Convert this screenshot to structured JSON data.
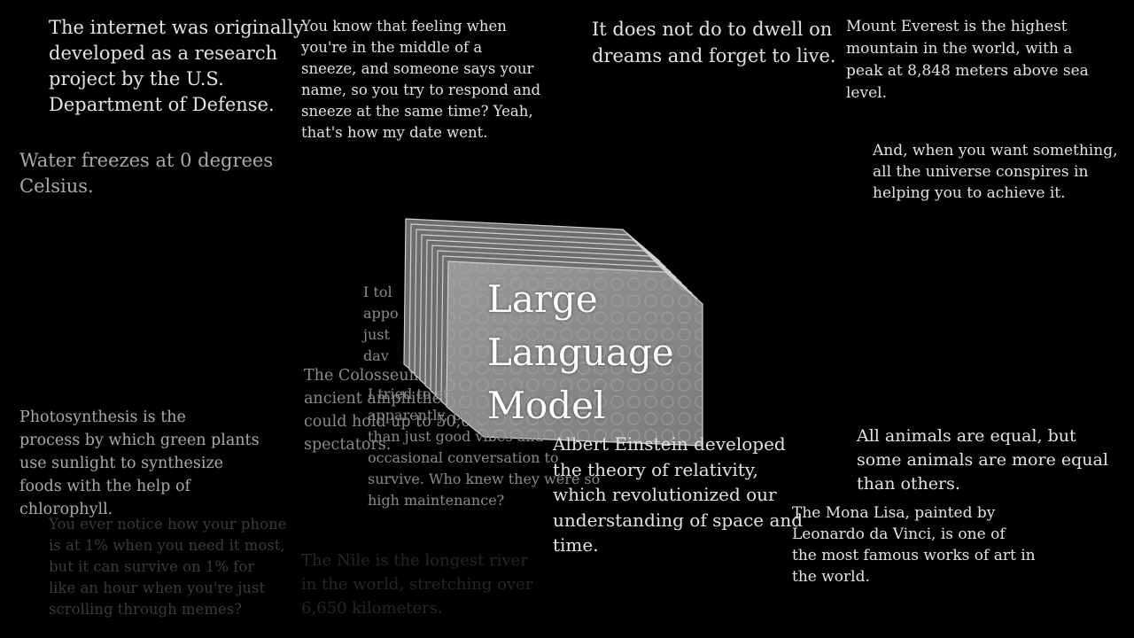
{
  "snippets": {
    "internet": "The internet was originally\ndeveloped as a research\nproject by the U.S.\nDepartment of Defense.",
    "sneeze": "You know that feeling when\nyou're in the middle of a\nsneeze, and someone says your\nname, so you try to respond and\nsneeze at the same time? Yeah,\nthat's how my date went.",
    "dreams": "It does not do to dwell on\ndreams and forget to live.",
    "everest": "Mount Everest is the highest\nmountain in the world, with a\npeak at 8,848 meters above sea\nlevel.",
    "water": "Water freezes at 0 degrees\nCelsius.",
    "universe": "And, when you want something,\nall the universe conspires in\nhelping you to achieve it.",
    "hidden_fragment": "I tol\nappo\njust\ndav",
    "colosseum": "The Colosseum in Rome is an\nancient amphitheater that\ncould hold up to 50,000\nspectators.",
    "plant": "I tried to start a garden, but\napparently, plants need more\nthan just good vibes and\noccasional conversation to\nsurvive. Who knew they were so\nhigh maintenance?",
    "photosynthesis": "Photosynthesis is the\nprocess by which green plants\nuse sunlight to synthesize\nfoods with the help of\nchlorophyll.",
    "einstein": "Albert Einstein developed\nthe theory of relativity,\nwhich revolutionized our\nunderstanding of space and\ntime.",
    "animals": "All animals are equal, but\nsome animals are more equal\nthan others.",
    "mona_lisa": "The Mona Lisa, painted by\nLeonardo da Vinci, is one of\nthe most famous works of art in\nthe world.",
    "phone": "You ever notice how your phone\nis at 1% when you need it most,\nbut it can survive on 1% for\nlike an hour when you're just\nscrolling through memes?",
    "nile": "The Nile is the longest river\nin the world, stretching over\n6,650 kilometers."
  },
  "model": {
    "line1": "Large",
    "line2": "Language",
    "line3": "Model"
  },
  "colors": {
    "background": "#000000",
    "stack_face": "#8e8e8e",
    "stack_edge": "#d0d0d0"
  }
}
